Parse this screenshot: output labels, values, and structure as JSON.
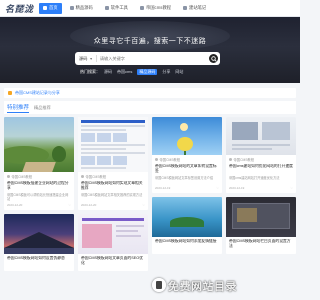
{
  "site": {
    "logo_text": "名琵泷"
  },
  "nav": {
    "items": [
      {
        "label": "首页",
        "active": true
      },
      {
        "label": "精品源码",
        "active": false
      },
      {
        "label": "软件工具",
        "active": false
      },
      {
        "label": "帝国cms教程",
        "active": false
      },
      {
        "label": "建站笔记",
        "active": false
      }
    ]
  },
  "hero": {
    "slogan": "众里寻它千百遍，搜索一下不迷路",
    "search": {
      "category": "源码",
      "placeholder": "请输入关键字"
    },
    "hot_label": "热门搜索：",
    "hot_tags": [
      {
        "label": "源码",
        "highlight": false
      },
      {
        "label": "帝国cms",
        "highlight": false
      },
      {
        "label": "精品源码",
        "highlight": true
      },
      {
        "label": "分享",
        "highlight": false
      },
      {
        "label": "网站",
        "highlight": false
      }
    ]
  },
  "notice": {
    "text": "帝国CMS建站记录与分享"
  },
  "section": {
    "title": "特别推荐",
    "subtitle": "精品推荐"
  },
  "cards": [
    {
      "category": "帝国CMS教程",
      "title": "帝国CMS模板搭建企业网站的过程分享",
      "desc": "帝国CMS模板可以帮助站长快速搭建企业网站",
      "date": "2023-12-20"
    },
    {
      "category": "帝国CMS教程",
      "title": "帝国CMS模板网站如何实现文章相关推荐",
      "desc": "帝国CMS模板网站文章相关推荐的实现方法",
      "date": "2023-12-20"
    },
    {
      "category": "帝国CMS教程",
      "title": "帝国CMS模板网站的文章如何设置标签",
      "desc": "帝国CMS模板网站文章标签设置方法介绍",
      "date": "2023-12-19"
    },
    {
      "category": "帝国CMS教程",
      "title": "帝国cms建站如何优化网站的打开速度",
      "desc": "帝国cms建站网站打开速度优化方法",
      "date": "2023-12-19"
    },
    {
      "category": "帝国CMS教程",
      "title": "帝国CMS模板网站如何设置伪静态",
      "desc": "",
      "date": ""
    },
    {
      "category": "帝国CMS教程",
      "title": "帝国CMS模板网站文章页面的SEO优化",
      "desc": "",
      "date": ""
    },
    {
      "category": "帝国CMS教程",
      "title": "帝国CMS模板网站如何添加友情链接",
      "desc": "",
      "date": ""
    },
    {
      "category": "帝国CMS教程",
      "title": "帝国CMS模板网站栏目页面的设置方法",
      "desc": "",
      "date": ""
    }
  ],
  "watermark": {
    "text": "免费网站目录"
  },
  "colors": {
    "accent": "#2d7ff9",
    "hero_bg": "#242835"
  }
}
